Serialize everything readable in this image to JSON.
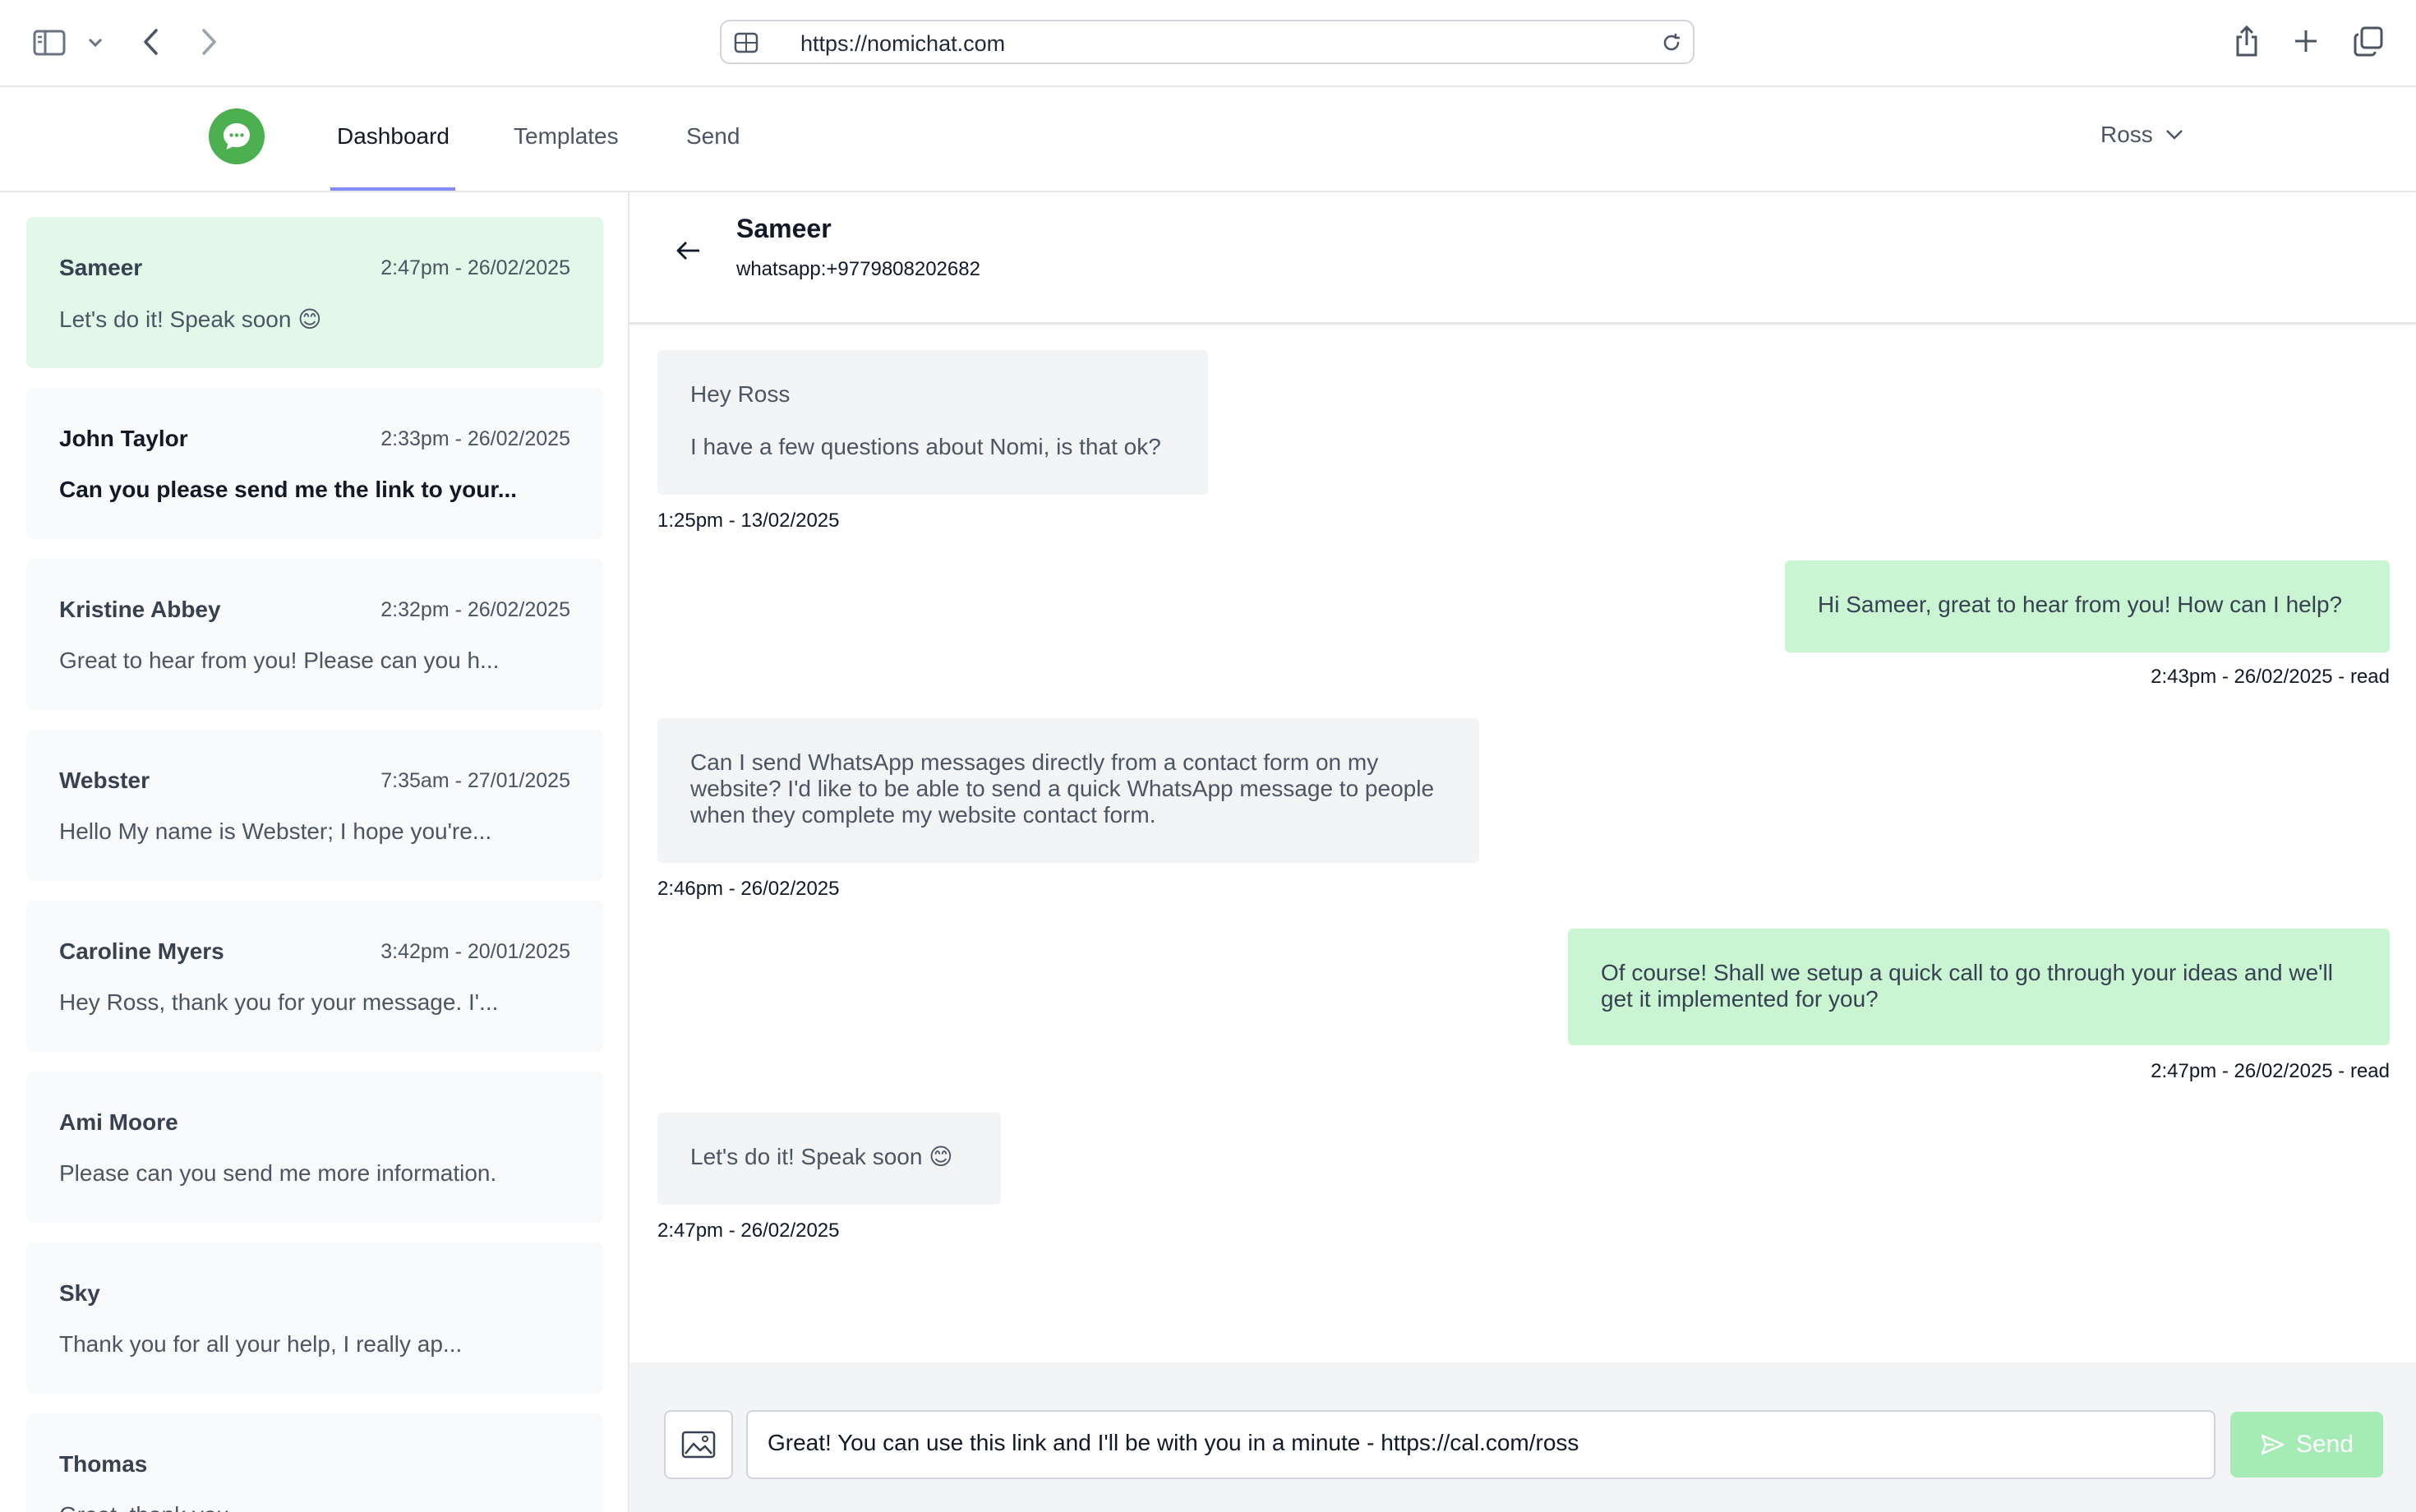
{
  "browser": {
    "url": "https://nomichat.com",
    "icons": [
      "sidebar-toggle-icon",
      "chevron-down-icon",
      "back-icon",
      "forward-icon",
      "globe-icon",
      "reload-icon",
      "share-icon",
      "plus-icon",
      "tabs-icon"
    ]
  },
  "header": {
    "tabs": [
      {
        "label": "Dashboard",
        "active": true
      },
      {
        "label": "Templates",
        "active": false
      },
      {
        "label": "Send",
        "active": false
      }
    ],
    "user": "Ross",
    "accent": "#818cf8",
    "logo_color": "#4caf50"
  },
  "conversations": [
    {
      "name": "Sameer",
      "time": "2:47pm - 26/02/2025",
      "preview": "Let's do it! Speak soon 😊",
      "active": true
    },
    {
      "name": "John Taylor",
      "time": "2:33pm - 26/02/2025",
      "preview": "Can you please send me the link to your...",
      "unread": true
    },
    {
      "name": "Kristine Abbey",
      "time": "2:32pm - 26/02/2025",
      "preview": "Great to hear from you! Please can you h..."
    },
    {
      "name": "Webster",
      "time": "7:35am - 27/01/2025",
      "preview": "Hello My name is Webster; I hope you're..."
    },
    {
      "name": "Caroline Myers",
      "time": "3:42pm - 20/01/2025",
      "preview": "Hey Ross, thank you for your message. I'..."
    },
    {
      "name": "Ami Moore",
      "time": "",
      "preview": "Please can you send me more information."
    },
    {
      "name": "Sky",
      "time": "",
      "preview": "Thank you for all your help, I really ap..."
    },
    {
      "name": "Thomas",
      "time": "",
      "preview": "Great, thank you"
    }
  ],
  "chat": {
    "contact_name": "Sameer",
    "contact_number": "whatsapp:+9779808202682",
    "messages": [
      {
        "direction": "in",
        "lines": [
          "Hey Ross",
          "I have a few questions about Nomi, is that ok?"
        ],
        "time": "1:25pm - 13/02/2025"
      },
      {
        "direction": "out",
        "lines": [
          "Hi Sameer, great to hear from you! How can I help?"
        ],
        "time": "2:43pm - 26/02/2025 - read"
      },
      {
        "direction": "in",
        "lines": [
          "Can I send WhatsApp messages directly from a contact form on my website? I'd like to be able to send a quick WhatsApp message to people when they complete my website contact form."
        ],
        "time": "2:46pm - 26/02/2025"
      },
      {
        "direction": "out",
        "lines": [
          "Of course! Shall we setup a quick call to go through your ideas and we'll get it implemented for you?"
        ],
        "time": "2:47pm - 26/02/2025 - read"
      },
      {
        "direction": "in",
        "lines": [
          "Let's do it! Speak soon 😊"
        ],
        "time": "2:47pm - 26/02/2025"
      }
    ]
  },
  "composer": {
    "value": "Great! You can use this link and I'll be with you in a minute - https://cal.com/ross",
    "send_label": "Send",
    "send_color": "#a5ebb5"
  }
}
